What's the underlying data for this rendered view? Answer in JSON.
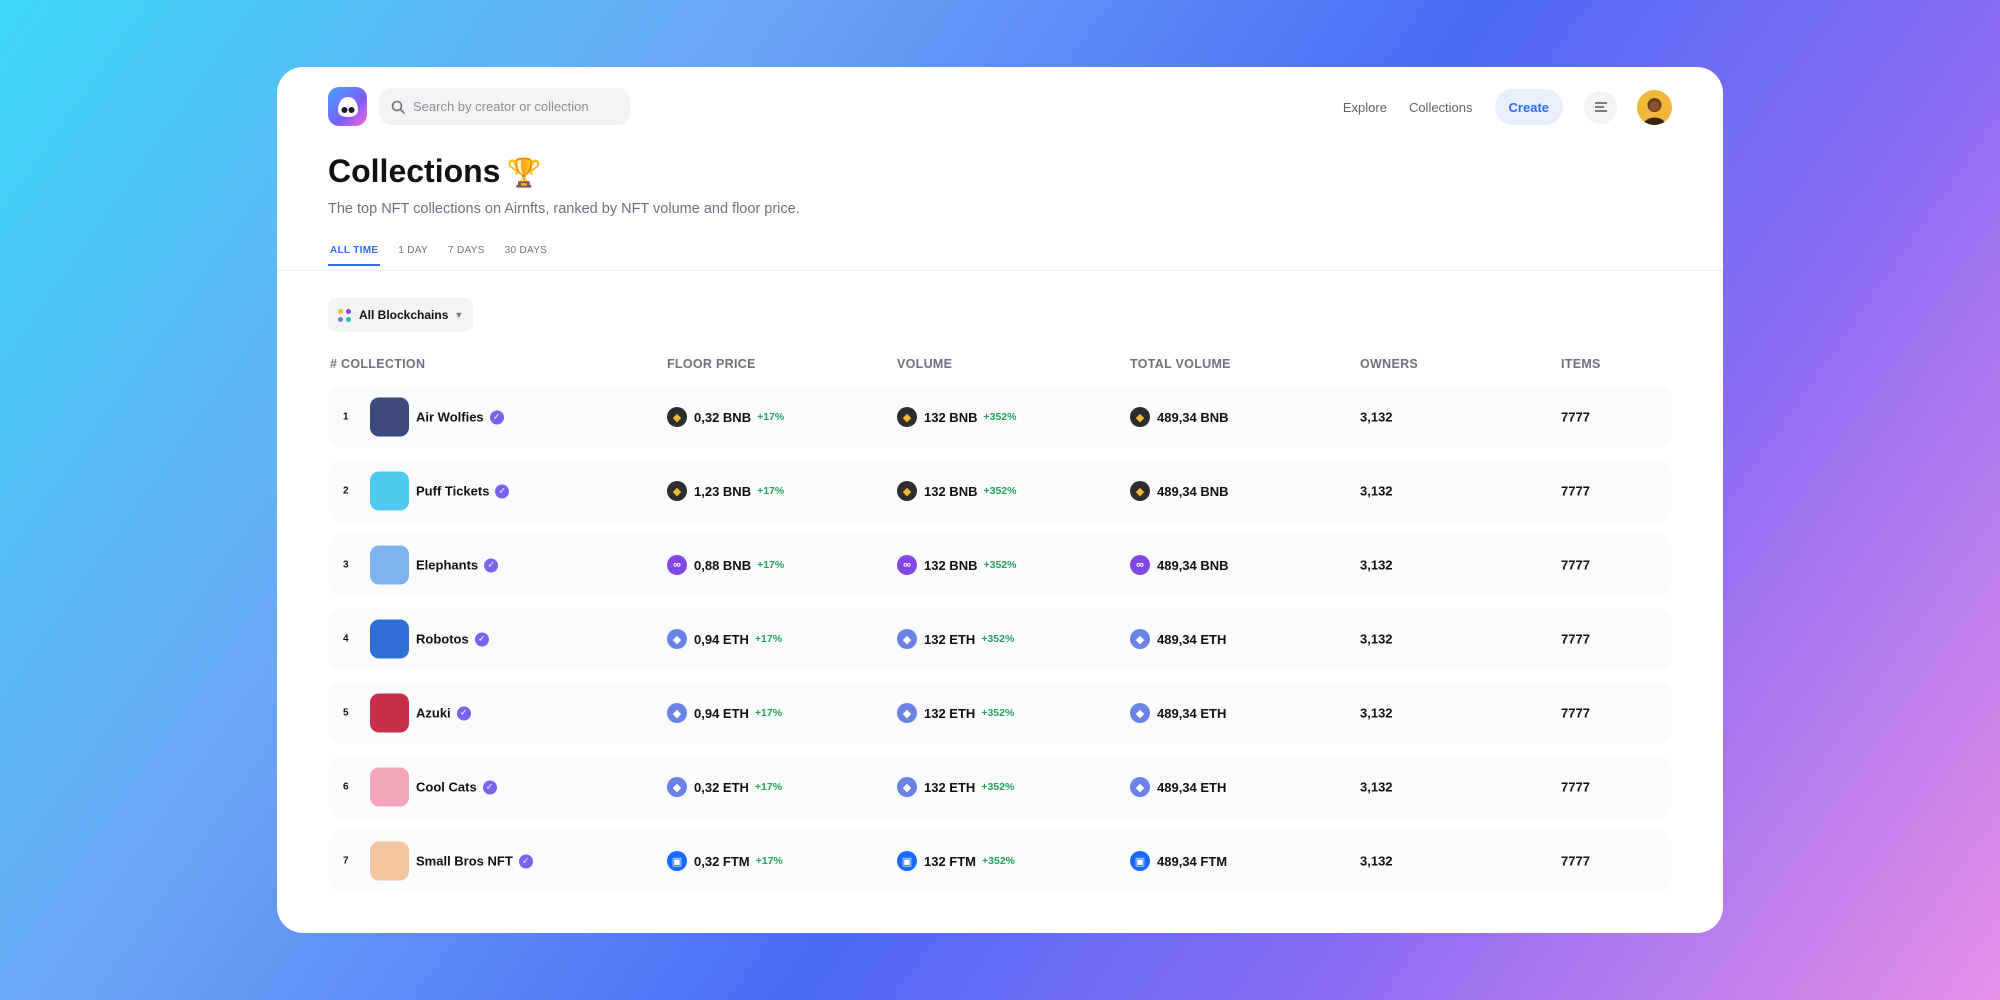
{
  "header": {
    "search_placeholder": "Search by creator or collection",
    "nav": [
      "Explore",
      "Collections"
    ],
    "create_label": "Create"
  },
  "page": {
    "title": "Collections",
    "title_emoji": "🏆",
    "subtitle": "The top NFT collections on Airnfts, ranked by NFT volume and floor price."
  },
  "tabs": [
    "ALL TIME",
    "1 DAY",
    "7 DAYS",
    "30 DAYS"
  ],
  "active_tab": "ALL TIME",
  "filter": {
    "chain_label": "All Blockchains"
  },
  "table": {
    "headers": [
      "# COLLECTION",
      "FLOOR PRICE",
      "VOLUME",
      "TOTAL VOLUME",
      "OWNERS",
      "ITEMS"
    ],
    "rows": [
      {
        "rank": "1",
        "name": "Air Wolfies",
        "coin": "bnb",
        "thumb": "#3b4a7a",
        "floor": "0,32 BNB",
        "floor_change": "+17%",
        "volume": "132 BNB",
        "volume_change": "+352%",
        "total": "489,34 BNB",
        "owners": "3,132",
        "items": "7777"
      },
      {
        "rank": "2",
        "name": "Puff Tickets",
        "coin": "bnb",
        "thumb": "#4ec9f0",
        "floor": "1,23 BNB",
        "floor_change": "+17%",
        "volume": "132 BNB",
        "volume_change": "+352%",
        "total": "489,34 BNB",
        "owners": "3,132",
        "items": "7777"
      },
      {
        "rank": "3",
        "name": "Elephants",
        "coin": "poly",
        "thumb": "#7fb2f0",
        "floor": "0,88 BNB",
        "floor_change": "+17%",
        "volume": "132 BNB",
        "volume_change": "+352%",
        "total": "489,34 BNB",
        "owners": "3,132",
        "items": "7777"
      },
      {
        "rank": "4",
        "name": "Robotos",
        "coin": "eth",
        "thumb": "#2f6fd6",
        "floor": "0,94 ETH",
        "floor_change": "+17%",
        "volume": "132 ETH",
        "volume_change": "+352%",
        "total": "489,34 ETH",
        "owners": "3,132",
        "items": "7777"
      },
      {
        "rank": "5",
        "name": "Azuki",
        "coin": "eth",
        "thumb": "#c8304a",
        "floor": "0,94 ETH",
        "floor_change": "+17%",
        "volume": "132 ETH",
        "volume_change": "+352%",
        "total": "489,34 ETH",
        "owners": "3,132",
        "items": "7777"
      },
      {
        "rank": "6",
        "name": "Cool Cats",
        "coin": "eth",
        "thumb": "#f4a6b8",
        "floor": "0,32 ETH",
        "floor_change": "+17%",
        "volume": "132 ETH",
        "volume_change": "+352%",
        "total": "489,34 ETH",
        "owners": "3,132",
        "items": "7777"
      },
      {
        "rank": "7",
        "name": "Small Bros NFT",
        "coin": "ftm",
        "thumb": "#f2c6a0",
        "floor": "0,32 FTM",
        "floor_change": "+17%",
        "volume": "132 FTM",
        "volume_change": "+352%",
        "total": "489,34 FTM",
        "owners": "3,132",
        "items": "7777"
      }
    ]
  },
  "colors": {
    "accent": "#2f6bff",
    "positive": "#22a35a",
    "verified": "#7a63f0"
  },
  "icons": {
    "bnb": "bnb-coin-icon",
    "eth": "eth-coin-icon",
    "poly": "polygon-coin-icon",
    "ftm": "fantom-coin-icon"
  }
}
